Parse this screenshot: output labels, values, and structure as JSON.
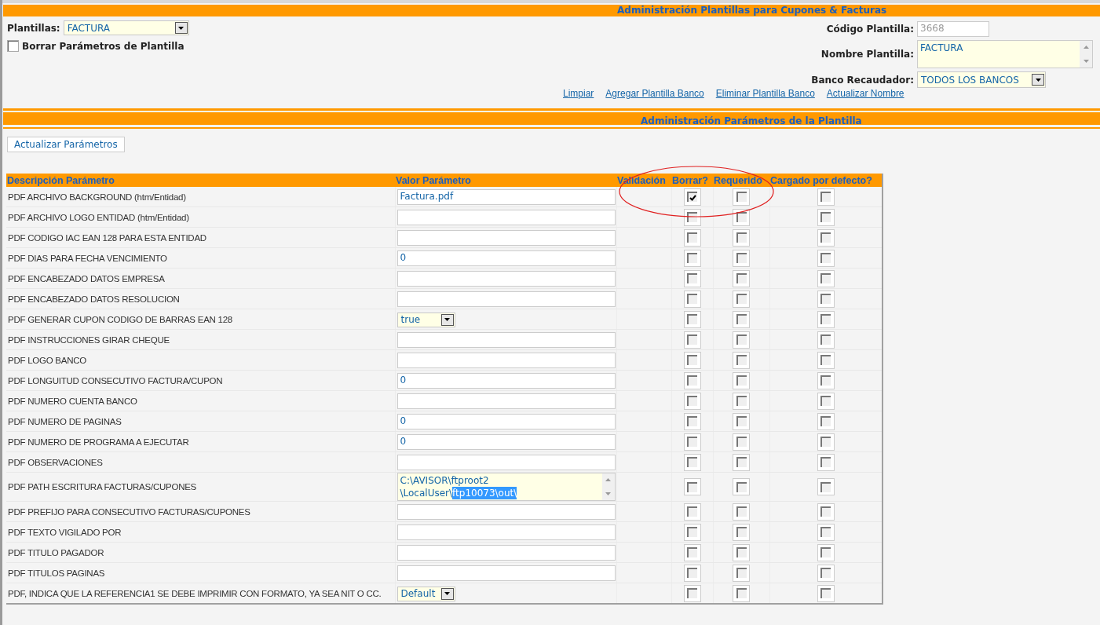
{
  "header": {
    "title": "Administración Plantillas para Cupones & Facturas"
  },
  "template_form": {
    "plantillas": {
      "label": "Plantillas:",
      "value": "FACTURA"
    },
    "delete_params": {
      "label": "Borrar Parámetros de Plantilla",
      "checked": false
    },
    "codigo": {
      "label": "Código Plantilla:",
      "value": "3668",
      "disabled": true
    },
    "nombre": {
      "label": "Nombre Plantilla:",
      "value": "FACTURA"
    },
    "banco": {
      "label": "Banco Recaudador:",
      "value": "TODOS LOS BANCOS"
    },
    "links": [
      "Limpiar",
      "Agregar Plantilla Banco",
      "Eliminar Plantilla Banco",
      "Actualizar Nombre"
    ]
  },
  "params_header": {
    "title": "Administración Parámetros de la Plantilla"
  },
  "update_button": "Actualizar Parámetros",
  "table": {
    "columns": [
      "Descripción Parámetro",
      "Valor Parámetro",
      "Validación",
      "Borrar?",
      "Requerido",
      "Cargado por defecto?"
    ],
    "rows": [
      {
        "description": "PDF ARCHIVO BACKGROUND (htm/Entidad)",
        "kind": "text",
        "value": "Factura.pdf",
        "borrar": true,
        "requerido": false,
        "cargado": false
      },
      {
        "description": "PDF ARCHIVO LOGO ENTIDAD (htm/Entidad)",
        "kind": "text",
        "borrar": false,
        "requerido": false,
        "cargado": false
      },
      {
        "description": "PDF CODIGO IAC EAN 128 PARA ESTA ENTIDAD",
        "kind": "text",
        "borrar": false,
        "requerido": false,
        "cargado": false
      },
      {
        "description": "PDF DIAS PARA FECHA VENCIMIENTO",
        "kind": "text",
        "value": "0",
        "borrar": false,
        "requerido": false,
        "cargado": false
      },
      {
        "description": "PDF ENCABEZADO DATOS EMPRESA",
        "kind": "text",
        "borrar": false,
        "requerido": false,
        "cargado": false
      },
      {
        "description": "PDF ENCABEZADO DATOS RESOLUCION",
        "kind": "text",
        "borrar": false,
        "requerido": false,
        "cargado": false
      },
      {
        "description": "PDF GENERAR CUPON CODIGO DE BARRAS EAN 128",
        "kind": "select",
        "value": "true",
        "borrar": false,
        "requerido": false,
        "cargado": false
      },
      {
        "description": "PDF INSTRUCCIONES GIRAR CHEQUE",
        "kind": "text",
        "borrar": false,
        "requerido": false,
        "cargado": false
      },
      {
        "description": "PDF LOGO BANCO",
        "kind": "text",
        "borrar": false,
        "requerido": false,
        "cargado": false
      },
      {
        "description": "PDF LONGUITUD CONSECUTIVO FACTURA/CUPON",
        "kind": "text",
        "value": "0",
        "borrar": false,
        "requerido": false,
        "cargado": false
      },
      {
        "description": "PDF NUMERO CUENTA BANCO",
        "kind": "text",
        "borrar": false,
        "requerido": false,
        "cargado": false
      },
      {
        "description": "PDF NUMERO DE PAGINAS",
        "kind": "text",
        "value": "0",
        "borrar": false,
        "requerido": false,
        "cargado": false
      },
      {
        "description": "PDF NUMERO DE PROGRAMA A EJECUTAR",
        "kind": "text",
        "value": "0",
        "borrar": false,
        "requerido": false,
        "cargado": false
      },
      {
        "description": "PDF OBSERVACIONES",
        "kind": "text",
        "borrar": false,
        "requerido": false,
        "cargado": false
      },
      {
        "description": "PDF PATH ESCRITURA FACTURAS/CUPONES",
        "kind": "textarea",
        "lines": [
          {
            "text": "C:\\AVISOR\\ftproot2"
          },
          {
            "text": "\\LocalUser\\",
            "highlight": "ftp10073\\out\\"
          }
        ],
        "borrar": false,
        "requerido": false,
        "cargado": false
      },
      {
        "description": "PDF PREFIJO PARA CONSECUTIVO FACTURAS/CUPONES",
        "kind": "text",
        "borrar": false,
        "requerido": false,
        "cargado": false
      },
      {
        "description": "PDF TEXTO VIGILADO POR",
        "kind": "text",
        "borrar": false,
        "requerido": false,
        "cargado": false
      },
      {
        "description": "PDF TITULO PAGADOR",
        "kind": "text",
        "borrar": false,
        "requerido": false,
        "cargado": false
      },
      {
        "description": "PDF TITULOS PAGINAS",
        "kind": "text",
        "borrar": false,
        "requerido": false,
        "cargado": false
      },
      {
        "description": "PDF, INDICA QUE LA REFERENCIA1 SE DEBE IMPRIMIR CON FORMATO, YA SEA NIT O CC.",
        "kind": "select",
        "value": "Default",
        "borrar": false,
        "requerido": false,
        "cargado": false
      }
    ]
  }
}
